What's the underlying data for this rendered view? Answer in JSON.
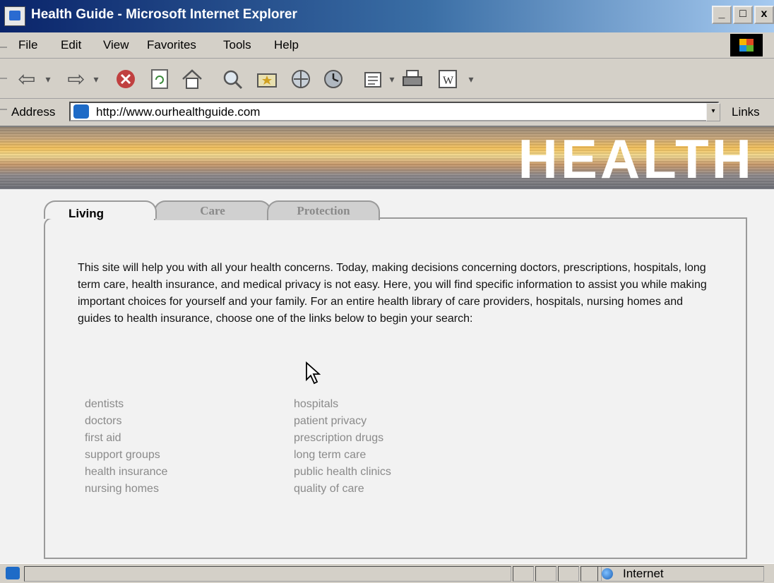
{
  "window": {
    "title": "Health Guide - Microsoft Internet Explorer",
    "minimize": "_",
    "maximize": "□",
    "close": "x"
  },
  "menu": [
    "File",
    "Edit",
    "View",
    "Favorites",
    "Tools",
    "Help"
  ],
  "toolbar": {
    "icons": [
      "back-icon",
      "forward-icon",
      "stop-icon",
      "refresh-icon",
      "home-icon",
      "search-icon",
      "favorites-icon",
      "history-icon",
      "media-icon",
      "mail-icon",
      "print-icon",
      "edit-word-icon"
    ],
    "dropdown_glyph": "▾"
  },
  "address": {
    "label": "Address",
    "url": "http://www.ourhealthguide.com",
    "links_label": "Links"
  },
  "banner": {
    "word": "HEALTH"
  },
  "tabs": [
    {
      "label": "Living",
      "active": true
    },
    {
      "label": "Care",
      "active": false
    },
    {
      "label": "Protection",
      "active": false
    }
  ],
  "intro": "This site will help you with all your health concerns. Today, making decisions concerning doctors, prescriptions, hospitals, long term care, health insurance, and medical privacy is not easy.  Here, you will find specific information to assist you while making important choices for yourself and your family.  For an entire health library of care providers, hospitals, nursing homes and guides to health insurance, choose one of the links below to begin your search:",
  "links_left": [
    "dentists",
    "doctors",
    "first aid",
    "support groups",
    "health insurance",
    "nursing homes"
  ],
  "links_right": [
    "hospitals",
    "patient privacy",
    "prescription drugs",
    "long term care",
    "public health clinics",
    "quality of care"
  ],
  "status": {
    "zone": "Internet"
  },
  "colors": {
    "titlebar": "#0a246a",
    "link": "#8a8a8a",
    "chrome": "#d4d0c8"
  }
}
